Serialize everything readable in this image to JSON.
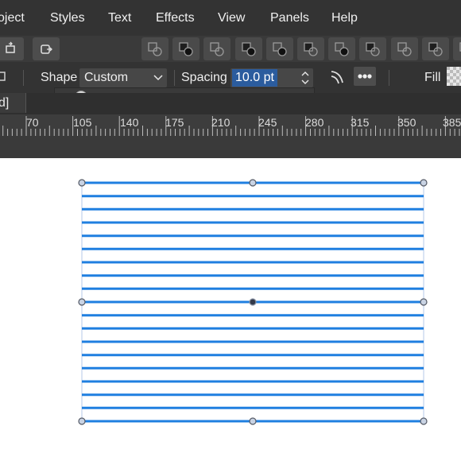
{
  "menu": {
    "items": [
      "oject",
      "Styles",
      "Text",
      "Effects",
      "View",
      "Panels",
      "Help"
    ]
  },
  "toolbar": {
    "left_buttons": [
      "flip-icon",
      "transform-icon"
    ],
    "boolean_buttons": [
      "add-icon",
      "subtract-icon",
      "intersect-icon",
      "divide-icon",
      "combine-icon",
      "exclude-icon",
      "xor-icon",
      "merge-icon",
      "split-icon",
      "crop-icon",
      "outline-icon"
    ]
  },
  "context": {
    "shape_label": "Shape",
    "shape_value": "Custom",
    "spacing_label": "Spacing",
    "spacing_value": "10.0 pt",
    "fill_label": "Fill",
    "spacing_slider": 0.08
  },
  "document": {
    "tab_text": "d]"
  },
  "ruler": {
    "labels": [
      "70",
      "105",
      "140",
      "175",
      "210",
      "245",
      "280",
      "315",
      "350",
      "385"
    ]
  },
  "colors": {
    "menubar": "#333333",
    "accent": "#2b5c9e",
    "stroke_blue": "#1f7fe0",
    "handle": "#555a66"
  }
}
